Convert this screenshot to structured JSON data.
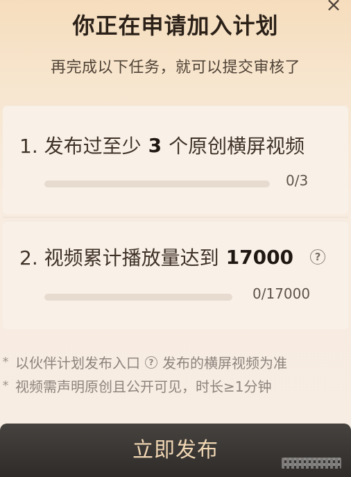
{
  "header": {
    "title": "你正在申请加入计划",
    "subtitle": "再完成以下任务，就可以提交审核了",
    "close_icon": "×"
  },
  "tasks": [
    {
      "prefix": "1. 发布过至少",
      "highlight": "3",
      "suffix": "个原创横屏视频",
      "progress_text_value": "0",
      "progress_text_total": "/3",
      "progress_ratio": 0,
      "has_help_icon": false
    },
    {
      "prefix": "2. 视频累计播放量达到",
      "highlight": "17000",
      "suffix": "",
      "progress_text_value": "0",
      "progress_text_total": "/17000",
      "progress_ratio": 0,
      "has_help_icon": true,
      "help_icon": "?"
    }
  ],
  "notes": {
    "line1_prefix": "以伙伴计划发布入口",
    "line1_suffix": "发布的横屏视频为准",
    "line1_help_icon": "?",
    "line2": "视频需声明原创且公开可见，时长≥1分钟",
    "bullet": "*"
  },
  "cta": {
    "label": "立即发布"
  },
  "colors": {
    "accent": "#c89e6d",
    "button_bg": "#353230",
    "button_text": "#f1d7b4",
    "background_top": "#f6ddbd",
    "background_bottom": "#f7ede3"
  },
  "icons": {
    "close": "close-icon",
    "help": "question-circle-icon"
  }
}
